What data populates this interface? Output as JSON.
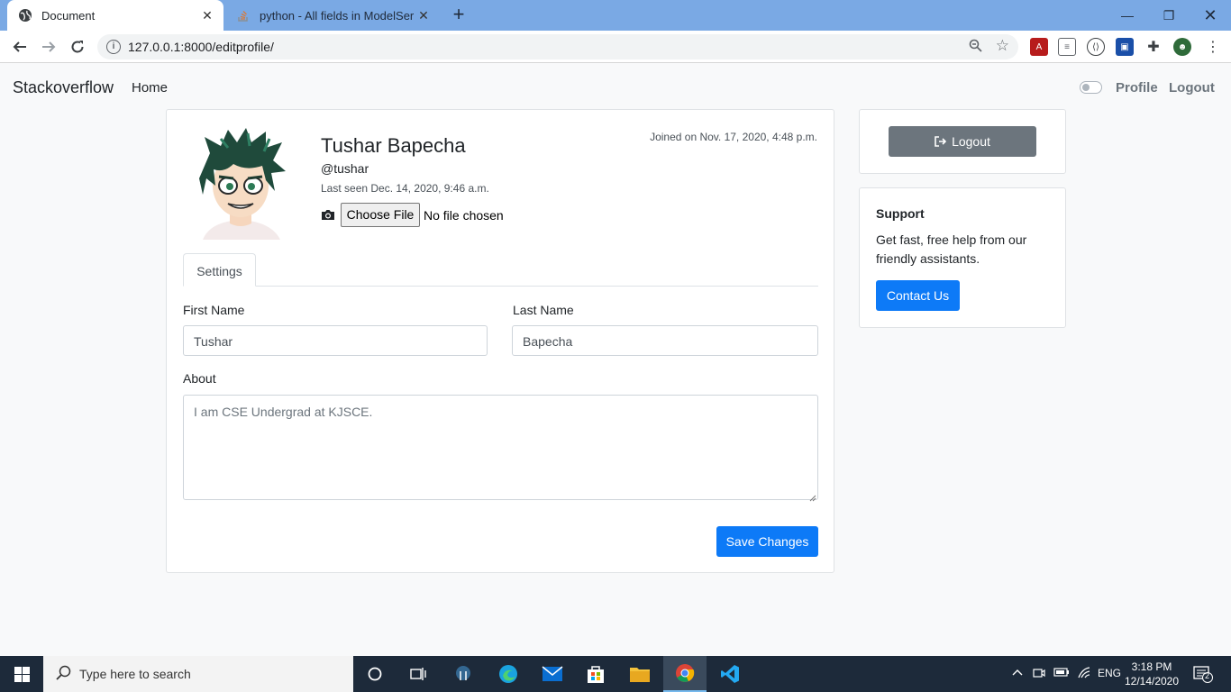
{
  "browser": {
    "tabs": [
      {
        "title": "Document",
        "active": true
      },
      {
        "title": "python - All fields in ModelSerial",
        "active": false
      }
    ],
    "url": "127.0.0.1:8000/editprofile/"
  },
  "navbar": {
    "brand": "Stackoverflow",
    "home": "Home",
    "profile": "Profile",
    "logout": "Logout"
  },
  "profile": {
    "name": "Tushar Bapecha",
    "handle": "@tushar",
    "last_seen": "Last seen Dec. 14, 2020, 9:46 a.m.",
    "joined": "Joined on Nov. 17, 2020, 4:48 p.m.",
    "file_button": "Choose File",
    "file_status": "No file chosen"
  },
  "form": {
    "tab": "Settings",
    "first_name_label": "First Name",
    "first_name_value": "Tushar",
    "last_name_label": "Last Name",
    "last_name_value": "Bapecha",
    "about_label": "About",
    "about_value": "I am CSE Undergrad at KJSCE.",
    "save_button": "Save Changes"
  },
  "sidebar": {
    "logout_button": "Logout",
    "support_title": "Support",
    "support_text": "Get fast, free help from our friendly assistants.",
    "contact_button": "Contact Us"
  },
  "taskbar": {
    "search_placeholder": "Type here to search",
    "language": "ENG",
    "time": "3:18 PM",
    "date": "12/14/2020",
    "notifications": "2"
  },
  "colors": {
    "primary": "#0d7af7",
    "secondary": "#6c757d",
    "tabbar": "#7aa9e4",
    "taskbar": "#1d2a3a"
  }
}
